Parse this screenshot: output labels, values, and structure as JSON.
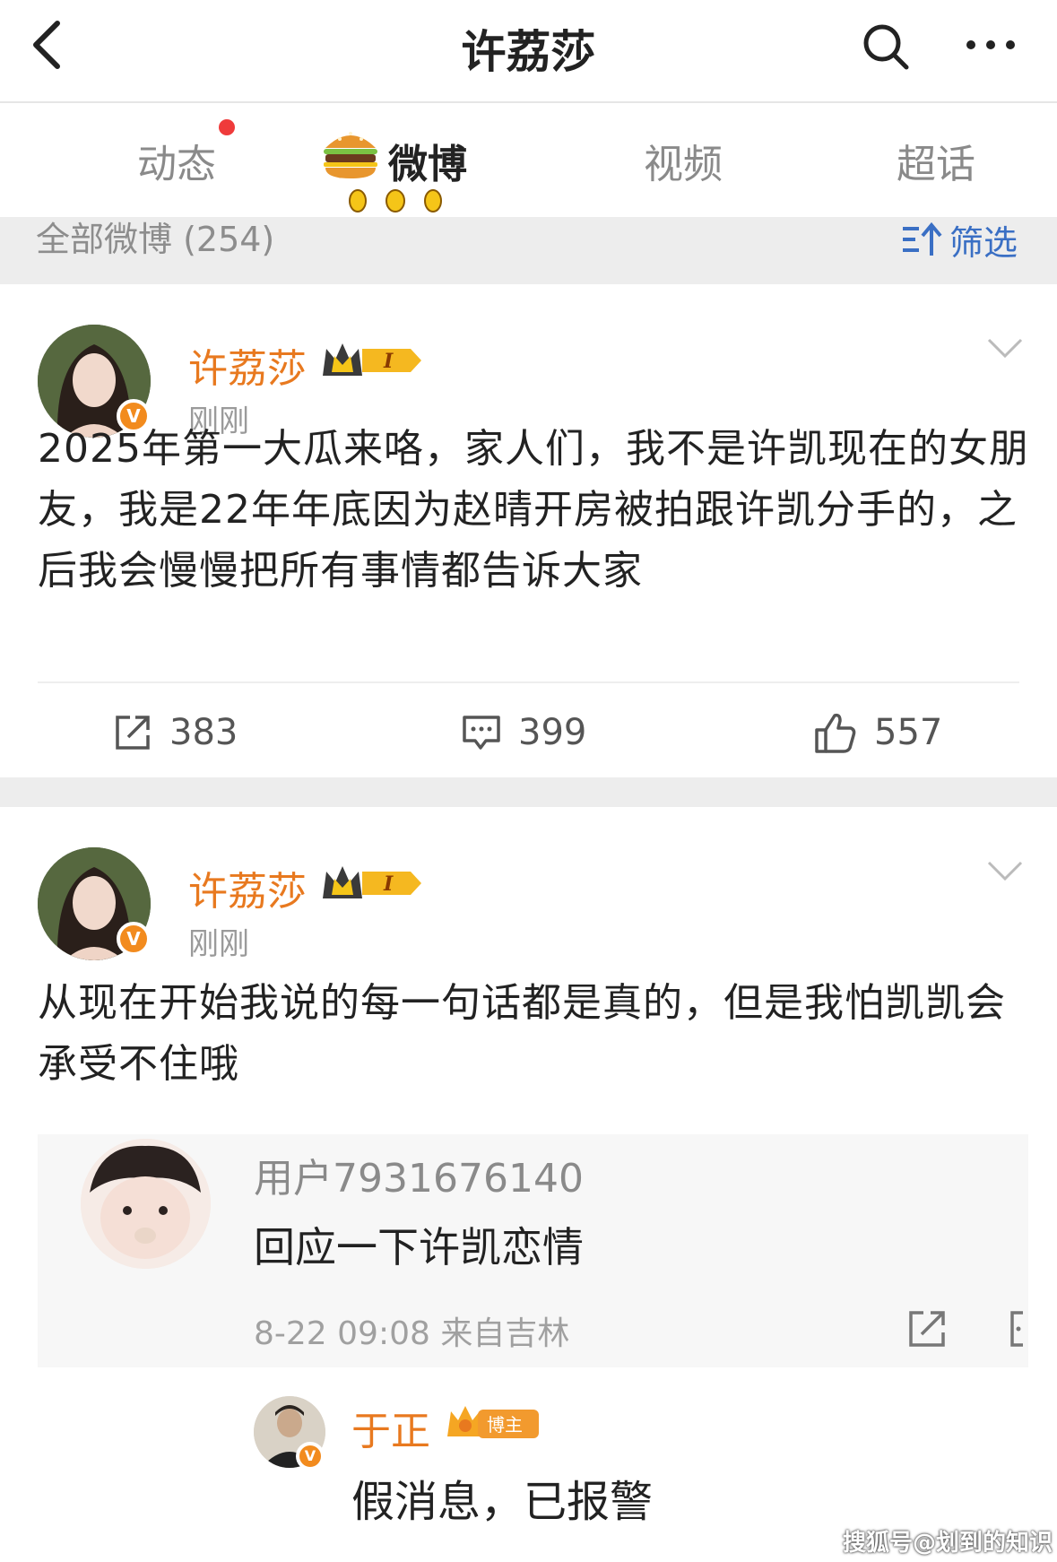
{
  "header": {
    "title": "许荔莎"
  },
  "tabs": [
    {
      "label": "动态",
      "has_dot": true
    },
    {
      "label": "微博",
      "active": true
    },
    {
      "label": "视频"
    },
    {
      "label": "超话"
    }
  ],
  "filter_bar": {
    "all_label": "全部微博 (254)",
    "filter_label": "筛选"
  },
  "posts": [
    {
      "username": "许荔莎",
      "vip_level": "I",
      "time": "刚刚",
      "text": "2025年第一大瓜来咯，家人们，我不是许凯现在的女朋友，我是22年年底因为赵晴开房被拍跟许凯分手的，之后我会慢慢把所有事情都告诉大家",
      "reposts": "383",
      "comments": "399",
      "likes": "557"
    },
    {
      "username": "许荔莎",
      "vip_level": "I",
      "time": "刚刚",
      "text": "从现在开始我说的每一句话都是真的，但是我怕凯凯会承受不住哦",
      "quote": {
        "user": "用户7931676140",
        "text": "回应一下许凯恋情",
        "meta": "8-22 09:08  来自吉林"
      },
      "reply": {
        "user": "于正",
        "badge": "博主",
        "text": "假消息，已报警"
      }
    }
  ],
  "watermark": "搜狐号@划到的知识",
  "colors": {
    "username": "#e8791f",
    "link": "#3a6fc4",
    "badge_orange": "#f28b1e",
    "dot": "#ef3b3b"
  }
}
